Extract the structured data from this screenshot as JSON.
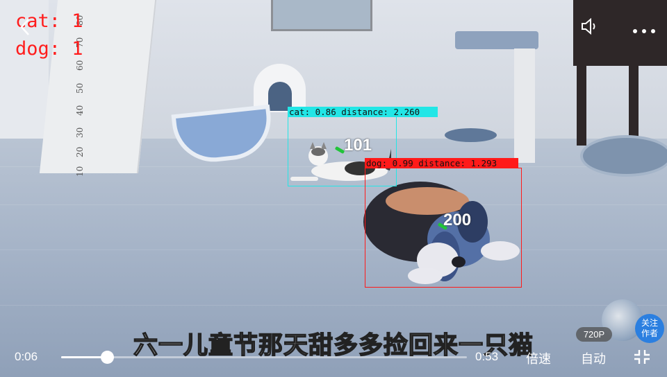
{
  "counts": [
    {
      "label": "cat: 1"
    },
    {
      "label": "dog: 1"
    }
  ],
  "detections": [
    {
      "label": "cat: 0.86  distance: 2.260",
      "track_id": "101",
      "color": "#22e6e6"
    },
    {
      "label": "dog: 0.99  distance: 1.293",
      "track_id": "200",
      "color": "#ff1a1a"
    }
  ],
  "ruler_marks": [
    "80",
    "70",
    "60",
    "50",
    "40",
    "30",
    "20",
    "10"
  ],
  "subtitle": "六一儿童节那天甜多多捡回来一只猫",
  "player": {
    "current_time": "0:06",
    "duration": "0:53",
    "progress_fraction": 0.113,
    "speed_label": "倍速",
    "auto_label": "自动",
    "quality": "720P",
    "follow_label_line1": "关注",
    "follow_label_line2": "作者"
  },
  "icons": {
    "back": "chevron-left-icon",
    "volume": "speaker-icon",
    "more": "more-dots-icon",
    "fullscreen_exit": "collapse-icon"
  },
  "colors": {
    "count_text": "#ff1d1d",
    "track_marker": "#22c43a",
    "follow_button": "#2b7fe0"
  }
}
